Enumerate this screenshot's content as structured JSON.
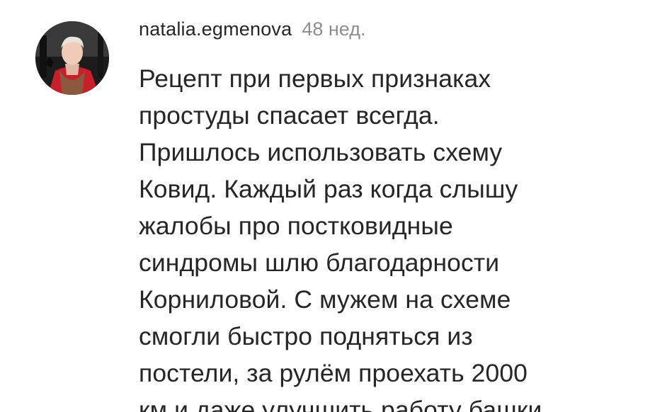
{
  "comment": {
    "avatar_icon": "user-profile-photo",
    "username": "natalia.egmenova",
    "timestamp": "48 нед.",
    "text_lines": [
      "Рецепт при первых признаках",
      "простуды спасает всегда.",
      "Пришлось использовать схему",
      "Ковид. Каждый раз когда слышу",
      "жалобы про постковидные",
      "синдромы шлю благодарности",
      "Корниловой. С мужем на схеме",
      "смогли быстро подняться из",
      "постели, за рулём проехать 2000",
      "км и даже улучшить работу башки."
    ]
  },
  "colors": {
    "text": "#262626",
    "secondary": "#8e8e8e",
    "background": "#ffffff"
  }
}
